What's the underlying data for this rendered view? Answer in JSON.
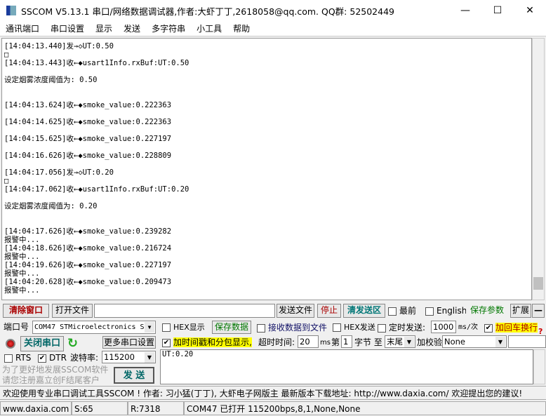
{
  "window": {
    "title": "SSCOM V5.13.1 串口/网络数据调试器,作者:大虾丁丁,2618058@qq.com. QQ群: 52502449",
    "minimize": "—",
    "maximize": "☐",
    "close": "✕"
  },
  "menu": [
    "通讯端口",
    "串口设置",
    "显示",
    "发送",
    "多字符串",
    "小工具",
    "帮助"
  ],
  "log": [
    "[14:04:13.440]发→◇UT:0.50",
    "□",
    "[14:04:13.443]收←◆usart1Info.rxBuf:UT:0.50",
    "",
    "设定烟雾浓度阈值为: 0.50",
    "",
    "",
    "[14:04:13.624]收←◆smoke_value:0.222363",
    "",
    "[14:04:14.625]收←◆smoke_value:0.222363",
    "",
    "[14:04:15.625]收←◆smoke_value:0.227197",
    "",
    "[14:04:16.626]收←◆smoke_value:0.228809",
    "",
    "[14:04:17.056]发→◇UT:0.20",
    "□",
    "[14:04:17.062]收←◆usart1Info.rxBuf:UT:0.20",
    "",
    "设定烟雾浓度阈值为: 0.20",
    "",
    "",
    "[14:04:17.626]收←◆smoke_value:0.239282",
    "报警中...",
    "[14:04:18.626]收←◆smoke_value:0.216724",
    "报警中...",
    "[14:04:19.626]收←◆smoke_value:0.227197",
    "报警中...",
    "[14:04:20.628]收←◆smoke_value:0.209473",
    "报警中..."
  ],
  "toolbar": {
    "clear": "清除窗口",
    "open_file": "打开文件",
    "file_path": "",
    "send_file": "发送文件",
    "stop": "停止",
    "clear_send": "清发送区",
    "topmost": "最前",
    "english": "English",
    "save_params": "保存参数",
    "expand": "扩展",
    "collapse": "—"
  },
  "port": {
    "label": "端口号",
    "value": "COM47 STMicroelectronics S",
    "close_port": "关闭串口",
    "more_settings": "更多串口设置",
    "rts": "RTS",
    "dtr": "DTR",
    "baud_label": "波特率:",
    "baud": "115200",
    "promo1": "为了更好地发展SSCOM软件",
    "promo2": "请您注册嘉立创F结尾客户",
    "send": "发 送"
  },
  "options": {
    "hex_display": "HEX显示",
    "save_data": "保存数据",
    "recv_to_file": "接收数据到文件",
    "hex_send": "HEX发送",
    "timed_send": "定时发送:",
    "interval": "1000",
    "interval_unit": "ms/次",
    "add_crlf": "加回车换行",
    "timestamp": "加时间戳和分包显示,",
    "timeout_label": "超时时间:",
    "timeout": "20",
    "timeout_unit": "ms",
    "byte_from_label": "第",
    "byte_from": "1",
    "byte_unit": "字节 至",
    "byte_to": "末尾",
    "checksum_label": "加校验",
    "checksum": "None"
  },
  "send_text": "UT:0.20",
  "marquee": "欢迎使用专业串口调试工具SSCOM !  作者: 习小猛(丁丁), 大虾电子网版主  最新版本下载地址: http://www.daxia.com/ 欢迎提出您的建议!",
  "statusbar": {
    "site": "www.daxia.com",
    "sent": "S:65",
    "recv": "R:7318",
    "port_status": "COM47 已打开  115200bps,8,1,None,None"
  },
  "checks": {
    "hex_display": false,
    "recv_to_file": false,
    "hex_send": false,
    "timed_send": false,
    "add_crlf": true,
    "timestamp": true,
    "rts": false,
    "dtr": true,
    "topmost": false,
    "english": false
  }
}
